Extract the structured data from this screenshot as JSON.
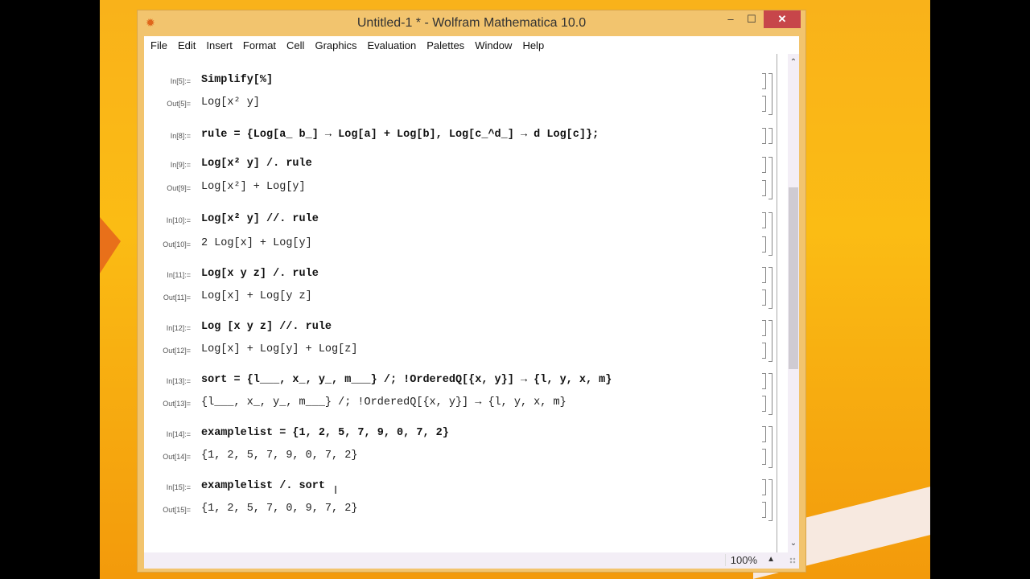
{
  "window": {
    "title": "Untitled-1 * - Wolfram Mathematica 10.0",
    "buttons": {
      "minimize": "–",
      "maximize": "☐",
      "close": "✕"
    },
    "app_icon": "mathematica-spikey-icon"
  },
  "menu": [
    "File",
    "Edit",
    "Insert",
    "Format",
    "Cell",
    "Graphics",
    "Evaluation",
    "Palettes",
    "Window",
    "Help"
  ],
  "cells": [
    {
      "label": "In[5]:=",
      "type": "in",
      "text": "Simplify[%]"
    },
    {
      "label": "Out[5]=",
      "type": "out",
      "text": "Log[x² y]"
    },
    {
      "label": "In[8]:=",
      "type": "in",
      "text": "rule = {Log[a_ b_] → Log[a] + Log[b], Log[c_^d_] → d Log[c]};"
    },
    {
      "label": "In[9]:=",
      "type": "in",
      "text": "Log[x² y] /. rule"
    },
    {
      "label": "Out[9]=",
      "type": "out",
      "text": "Log[x²] + Log[y]"
    },
    {
      "label": "In[10]:=",
      "type": "in",
      "text": "Log[x² y] //. rule"
    },
    {
      "label": "Out[10]=",
      "type": "out",
      "text": "2 Log[x] + Log[y]"
    },
    {
      "label": "In[11]:=",
      "type": "in",
      "text": "Log[x y z] /. rule"
    },
    {
      "label": "Out[11]=",
      "type": "out",
      "text": "Log[x] + Log[y z]"
    },
    {
      "label": "In[12]:=",
      "type": "in",
      "text": "Log [x y z] //. rule"
    },
    {
      "label": "Out[12]=",
      "type": "out",
      "text": "Log[x] + Log[y] + Log[z]"
    },
    {
      "label": "In[13]:=",
      "type": "in",
      "text": "sort = {l___, x_, y_, m___} /; !OrderedQ[{x, y}] → {l, y, x, m}"
    },
    {
      "label": "Out[13]=",
      "type": "out",
      "text": "{l___, x_, y_, m___} /; !OrderedQ[{x, y}] → {l, y, x, m}"
    },
    {
      "label": "In[14]:=",
      "type": "in",
      "text": "examplelist = {1, 2, 5, 7, 9, 0, 7, 2}"
    },
    {
      "label": "Out[14]=",
      "type": "out",
      "text": "{1, 2, 5, 7, 9, 0, 7, 2}"
    },
    {
      "label": "In[15]:=",
      "type": "in",
      "text": "examplelist /. sort"
    },
    {
      "label": "Out[15]=",
      "type": "out",
      "text": "{1, 2, 5, 7, 0, 9, 7, 2}"
    }
  ],
  "status": {
    "zoom": "100%",
    "zoom_arrow": "▲"
  },
  "scrollbar": {
    "up": "⌃",
    "down": "⌄",
    "position_fraction": 0.28,
    "visible_fraction": 0.37
  },
  "text_cursor": "I"
}
